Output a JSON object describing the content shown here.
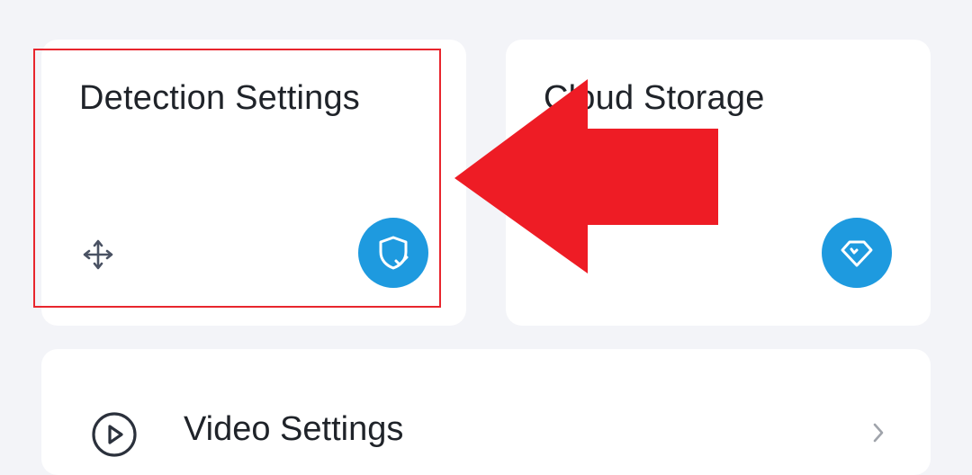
{
  "cards": {
    "detection": {
      "title": "Detection Settings",
      "drag_icon": "move-arrows-icon",
      "badge_icon": "shield-check-icon"
    },
    "cloud": {
      "title": "Cloud Storage",
      "badge_icon": "diamond-icon"
    }
  },
  "list": {
    "video_settings": {
      "label": "Video Settings",
      "icon": "play-circle-icon",
      "trailing_icon": "chevron-right-icon"
    }
  },
  "annotation": {
    "highlight_color": "#e8262e",
    "arrow_color": "#ee1c25",
    "arrow_direction": "left"
  },
  "colors": {
    "background": "#f3f4f8",
    "card": "#ffffff",
    "accent": "#1e9adf",
    "text": "#1f2329"
  }
}
